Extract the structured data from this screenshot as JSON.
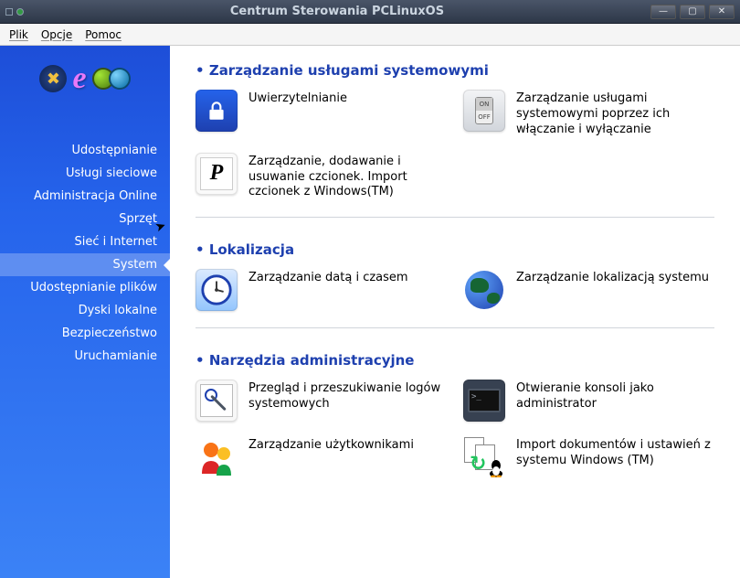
{
  "titlebar": {
    "title": "Centrum Sterowania PCLinuxOS"
  },
  "menubar": {
    "plik": "Plik",
    "opcje": "Opcje",
    "pomoc": "Pomoc"
  },
  "sidebar": {
    "items": [
      {
        "label": "Udostępnianie"
      },
      {
        "label": "Usługi sieciowe"
      },
      {
        "label": "Administracja Online"
      },
      {
        "label": "Sprzęt"
      },
      {
        "label": "Sieć i Internet"
      },
      {
        "label": "System"
      },
      {
        "label": "Udostępnianie plików"
      },
      {
        "label": "Dyski lokalne"
      },
      {
        "label": "Bezpieczeństwo"
      },
      {
        "label": "Uruchamianie"
      }
    ],
    "active_index": 5
  },
  "sections": [
    {
      "title": "Zarządzanie usługami systemowymi",
      "items": [
        {
          "icon": "lock-icon",
          "label": "Uwierzytelnianie"
        },
        {
          "icon": "switch-icon",
          "label": "Zarządzanie usługami systemowymi poprzez ich włączanie i wyłączanie"
        },
        {
          "icon": "font-icon",
          "label": "Zarządzanie, dodawanie i usuwanie czcionek. Import czcionek z Windows(TM)"
        }
      ]
    },
    {
      "title": "Lokalizacja",
      "items": [
        {
          "icon": "clock-icon",
          "label": "Zarządzanie datą i czasem"
        },
        {
          "icon": "globe-icon",
          "label": "Zarządzanie lokalizacją systemu"
        }
      ]
    },
    {
      "title": "Narzędzia administracyjne",
      "items": [
        {
          "icon": "logs-icon",
          "label": "Przegląd i przeszukiwanie logów systemowych"
        },
        {
          "icon": "console-icon",
          "label": "Otwieranie konsoli jako administrator"
        },
        {
          "icon": "users-icon",
          "label": "Zarządzanie użytkownikami"
        },
        {
          "icon": "import-icon",
          "label": "Import dokumentów i ustawień z systemu Windows (TM)"
        }
      ]
    }
  ]
}
